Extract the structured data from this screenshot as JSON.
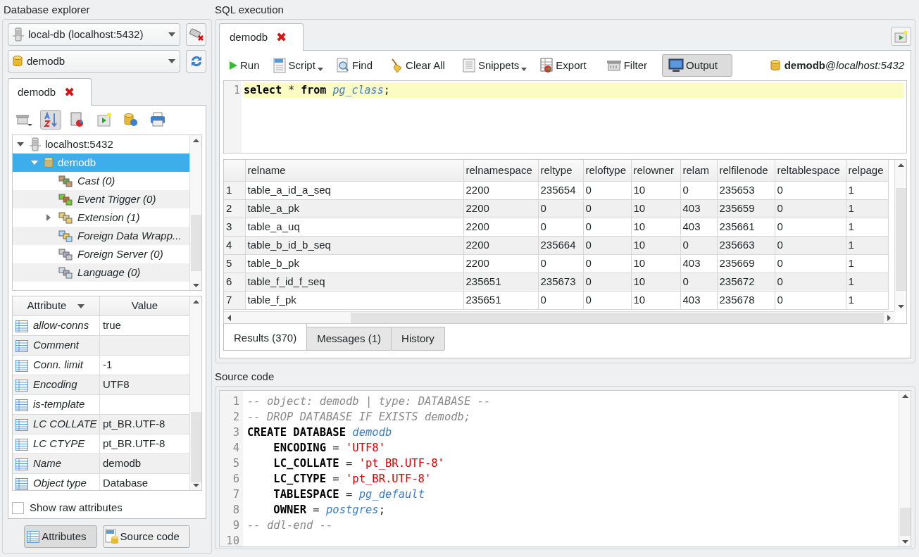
{
  "explorer": {
    "title": "Database explorer",
    "connection": "local-db (localhost:5432)",
    "database": "demodb",
    "tab": {
      "label": "demodb",
      "close": "✖"
    },
    "tree": [
      {
        "label": "localhost:5432",
        "has_children": true,
        "expanded": true,
        "selected": false,
        "children": [
          {
            "label": "demodb",
            "has_children": true,
            "expanded": true,
            "selected": true,
            "children": [
              {
                "label": "Cast (0)",
                "has_children": false,
                "expanded": false,
                "selected": false
              },
              {
                "label": "Event Trigger (0)",
                "has_children": false,
                "expanded": false,
                "selected": false
              },
              {
                "label": "Extension (1)",
                "has_children": true,
                "expanded": false,
                "selected": false
              },
              {
                "label": "Foreign Data Wrapp...",
                "has_children": false,
                "expanded": false,
                "selected": false
              },
              {
                "label": "Foreign Server (0)",
                "has_children": false,
                "expanded": false,
                "selected": false
              },
              {
                "label": "Language (0)",
                "has_children": false,
                "expanded": false,
                "selected": false
              }
            ]
          }
        ]
      }
    ],
    "attributes": {
      "columns": [
        "Attribute",
        "Value"
      ],
      "rows": [
        {
          "name": "allow-conns",
          "value": "true"
        },
        {
          "name": "Comment",
          "value": ""
        },
        {
          "name": "Conn. limit",
          "value": "-1"
        },
        {
          "name": "Encoding",
          "value": "UTF8"
        },
        {
          "name": "is-template",
          "value": ""
        },
        {
          "name": "LC COLLATE",
          "value": "pt_BR.UTF-8"
        },
        {
          "name": "LC CTYPE",
          "value": "pt_BR.UTF-8"
        },
        {
          "name": "Name",
          "value": "demodb"
        },
        {
          "name": "Object type",
          "value": "Database"
        }
      ]
    },
    "show_raw": {
      "label": "Show raw attributes",
      "checked": false
    },
    "buttons": [
      {
        "label": "Attributes",
        "selected": true
      },
      {
        "label": "Source code",
        "selected": false
      }
    ]
  },
  "sql": {
    "title": "SQL execution",
    "tab": {
      "label": "demodb",
      "close": "✖"
    },
    "toolbar": [
      {
        "label": "Run",
        "dropdown": false,
        "selected": false
      },
      {
        "label": "Script",
        "dropdown": true,
        "selected": false
      },
      {
        "label": "Find",
        "dropdown": false,
        "selected": false
      },
      {
        "label": "Clear All",
        "dropdown": false,
        "selected": false
      },
      {
        "label": "Snippets",
        "dropdown": true,
        "selected": false
      },
      {
        "label": "Export",
        "dropdown": false,
        "selected": false
      },
      {
        "label": "Filter",
        "dropdown": false,
        "selected": false
      },
      {
        "label": "Output",
        "dropdown": false,
        "selected": true
      }
    ],
    "connection": "**demodb**@*localhost:5432*",
    "editor": {
      "lines": [
        {
          "number": "1",
          "current": true,
          "tokens": [
            {
              "kind": "keyword",
              "text": "select"
            },
            {
              "kind": "plain",
              "text": " * "
            },
            {
              "kind": "keyword",
              "text": "from "
            },
            {
              "kind": "ident",
              "text": "pg_class"
            },
            {
              "kind": "plain",
              "text": ";"
            }
          ]
        }
      ]
    },
    "results": {
      "columns": [
        "relname",
        "relnamespace",
        "reltype",
        "reloftype",
        "relowner",
        "relam",
        "relfilenode",
        "reltablespace",
        "relpage"
      ],
      "rows": [
        {
          "number": "1",
          "cells": [
            "table_a_id_a_seq",
            "2200",
            "235654",
            "0",
            "10",
            "0",
            "235653",
            "0",
            "1"
          ]
        },
        {
          "number": "2",
          "cells": [
            "table_a_pk",
            "2200",
            "0",
            "0",
            "10",
            "403",
            "235659",
            "0",
            "1"
          ]
        },
        {
          "number": "3",
          "cells": [
            "table_a_uq",
            "2200",
            "0",
            "0",
            "10",
            "403",
            "235661",
            "0",
            "1"
          ]
        },
        {
          "number": "4",
          "cells": [
            "table_b_id_b_seq",
            "2200",
            "235664",
            "0",
            "10",
            "0",
            "235663",
            "0",
            "1"
          ]
        },
        {
          "number": "5",
          "cells": [
            "table_b_pk",
            "2200",
            "0",
            "0",
            "10",
            "403",
            "235669",
            "0",
            "1"
          ]
        },
        {
          "number": "6",
          "cells": [
            "table_f_id_f_seq",
            "235651",
            "235673",
            "0",
            "10",
            "0",
            "235672",
            "0",
            "1"
          ]
        },
        {
          "number": "7",
          "cells": [
            "table_f_pk",
            "235651",
            "0",
            "0",
            "10",
            "403",
            "235678",
            "0",
            "1"
          ]
        }
      ]
    },
    "result_tabs": [
      {
        "label": "Results (370)",
        "selected": true
      },
      {
        "label": "Messages (1)",
        "selected": false
      },
      {
        "label": "History",
        "selected": false
      }
    ]
  },
  "source": {
    "title": "Source code",
    "lines": [
      {
        "number": "1",
        "indented": false,
        "tokens": [
          {
            "kind": "comment",
            "text": "-- object: demodb | type: DATABASE --"
          }
        ]
      },
      {
        "number": "2",
        "indented": false,
        "tokens": [
          {
            "kind": "comment",
            "text": "-- DROP DATABASE IF EXISTS demodb;"
          }
        ]
      },
      {
        "number": "3",
        "indented": false,
        "tokens": [
          {
            "kind": "keyword",
            "text": "CREATE DATABASE "
          },
          {
            "kind": "ident",
            "text": "demodb"
          }
        ]
      },
      {
        "number": "4",
        "indented": true,
        "tokens": [
          {
            "kind": "keyword",
            "text": "ENCODING"
          },
          {
            "kind": "plain",
            "text": " = "
          },
          {
            "kind": "string",
            "text": "'UTF8'"
          }
        ]
      },
      {
        "number": "5",
        "indented": true,
        "tokens": [
          {
            "kind": "keyword",
            "text": "LC_COLLATE"
          },
          {
            "kind": "plain",
            "text": " = "
          },
          {
            "kind": "string",
            "text": "'pt_BR.UTF-8'"
          }
        ]
      },
      {
        "number": "6",
        "indented": true,
        "tokens": [
          {
            "kind": "keyword",
            "text": "LC_CTYPE"
          },
          {
            "kind": "plain",
            "text": " = "
          },
          {
            "kind": "string",
            "text": "'pt_BR.UTF-8'"
          }
        ]
      },
      {
        "number": "7",
        "indented": true,
        "tokens": [
          {
            "kind": "keyword",
            "text": "TABLESPACE"
          },
          {
            "kind": "plain",
            "text": " = "
          },
          {
            "kind": "ident",
            "text": "pg_default"
          }
        ]
      },
      {
        "number": "8",
        "indented": true,
        "tokens": [
          {
            "kind": "keyword",
            "text": "OWNER"
          },
          {
            "kind": "plain",
            "text": " = "
          },
          {
            "kind": "ident",
            "text": "postgres"
          },
          {
            "kind": "plain",
            "text": ";"
          }
        ]
      },
      {
        "number": "9",
        "indented": false,
        "tokens": [
          {
            "kind": "comment",
            "text": "-- ddl-end --"
          }
        ]
      },
      {
        "number": "10"
      }
    ]
  }
}
